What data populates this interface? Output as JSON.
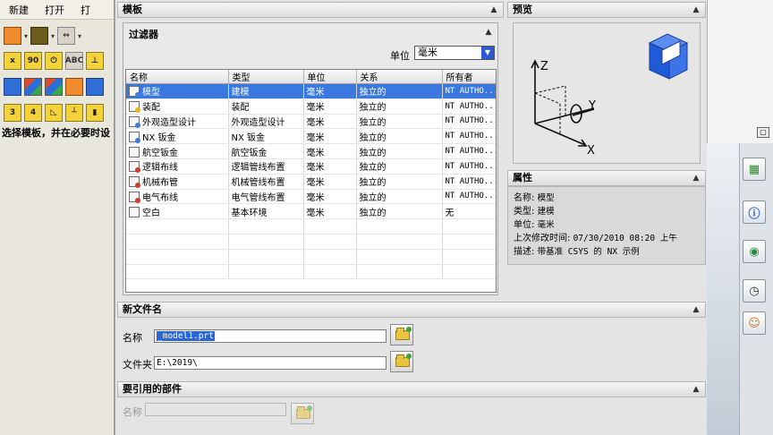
{
  "toolbar_left": {
    "menu": [
      "新建",
      "打开",
      "打"
    ],
    "row2_labels": [
      "x",
      "90",
      "ABC"
    ],
    "status_text": "选择模板，并在必要时设"
  },
  "template_section": {
    "title": "模板",
    "filter": {
      "title": "过滤器",
      "unit_label": "单位",
      "unit_value": "毫米"
    },
    "columns": [
      "名称",
      "类型",
      "单位",
      "关系",
      "所有者"
    ],
    "rows": [
      {
        "name": "模型",
        "type": "建模",
        "unit": "毫米",
        "relation": "独立的",
        "owner": "NT AUTHO...",
        "selected": true
      },
      {
        "name": "装配",
        "type": "装配",
        "unit": "毫米",
        "relation": "独立的",
        "owner": "NT AUTHO..."
      },
      {
        "name": "外观造型设计",
        "type": "外观造型设计",
        "unit": "毫米",
        "relation": "独立的",
        "owner": "NT AUTHO..."
      },
      {
        "name": "NX 钣金",
        "type": "NX 钣金",
        "unit": "毫米",
        "relation": "独立的",
        "owner": "NT AUTHO..."
      },
      {
        "name": "航空钣金",
        "type": "航空钣金",
        "unit": "毫米",
        "relation": "独立的",
        "owner": "NT AUTHO..."
      },
      {
        "name": "逻辑布线",
        "type": "逻辑管线布置",
        "unit": "毫米",
        "relation": "独立的",
        "owner": "NT AUTHO..."
      },
      {
        "name": "机械布管",
        "type": "机械管线布置",
        "unit": "毫米",
        "relation": "独立的",
        "owner": "NT AUTHO..."
      },
      {
        "name": "电气布线",
        "type": "电气管线布置",
        "unit": "毫米",
        "relation": "独立的",
        "owner": "NT AUTHO..."
      },
      {
        "name": "空白",
        "type": "基本环境",
        "unit": "毫米",
        "relation": "独立的",
        "owner": "无"
      }
    ]
  },
  "preview_section": {
    "title": "预览",
    "axes": [
      "Z",
      "Y",
      "X"
    ]
  },
  "properties_section": {
    "title": "属性",
    "items": [
      {
        "label": "名称:",
        "value": "模型"
      },
      {
        "label": "类型:",
        "value": "建模"
      },
      {
        "label": "单位:",
        "value": "毫米"
      },
      {
        "label": "上次修改时间:",
        "value": "07/30/2010 08:20 上午"
      },
      {
        "label": "描述:",
        "value": "带基准 CSYS 的 NX 示例"
      }
    ]
  },
  "new_filename_section": {
    "title": "新文件名",
    "name_label": "名称",
    "name_value": "_model1.prt",
    "folder_label": "文件夹",
    "folder_value": "E:\\2019\\"
  },
  "referenced_parts_section": {
    "title": "要引用的部件",
    "name_label": "名称",
    "name_value": ""
  },
  "colors": {
    "selection": "#3a78e0",
    "dropdown_button": "#2b5ad2"
  }
}
